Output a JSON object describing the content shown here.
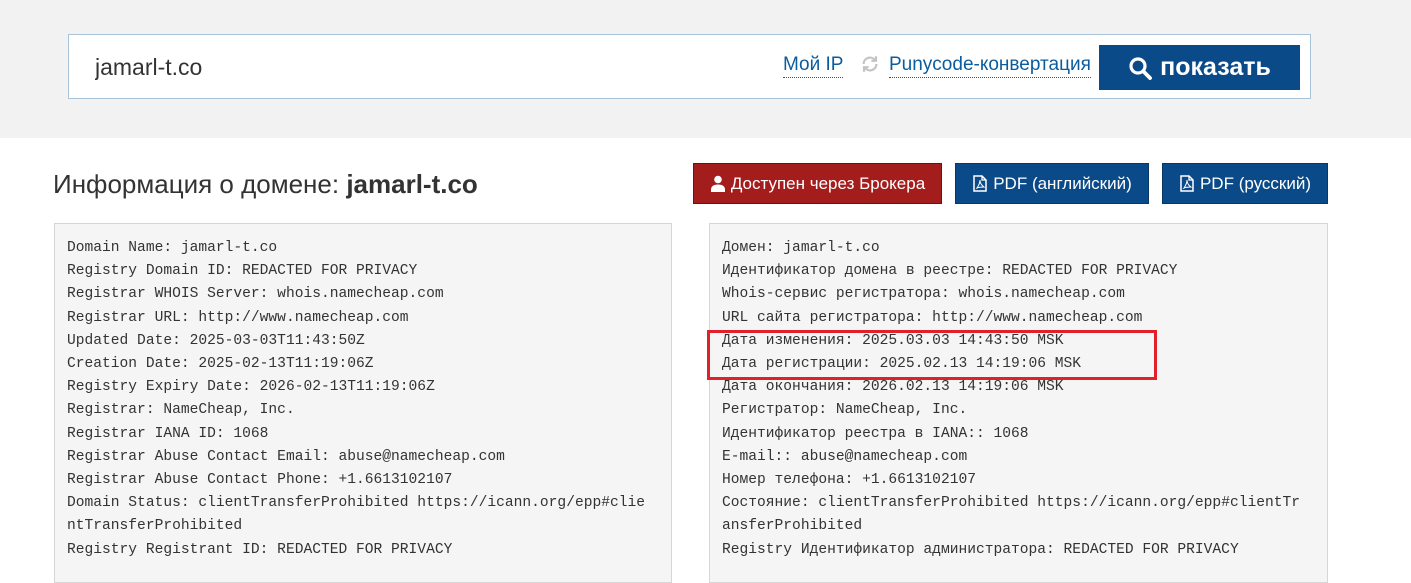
{
  "search": {
    "value": "jamarl-t.co",
    "my_ip_label": "Мой IP",
    "punycode_label": "Punycode-конвертация",
    "show_button_label": "показать"
  },
  "header": {
    "title_prefix": "Информация о домене: ",
    "domain": "jamarl-t.co"
  },
  "actions": {
    "broker_label": "Доступен через Брокера",
    "pdf_en_label": "PDF (английский)",
    "pdf_ru_label": "PDF (русский)"
  },
  "whois_en": [
    "Domain Name: jamarl-t.co",
    "Registry Domain ID: REDACTED FOR PRIVACY",
    "Registrar WHOIS Server: whois.namecheap.com",
    "Registrar URL: http://www.namecheap.com",
    "Updated Date: 2025-03-03T11:43:50Z",
    "Creation Date: 2025-02-13T11:19:06Z",
    "Registry Expiry Date: 2026-02-13T11:19:06Z",
    "Registrar: NameCheap, Inc.",
    "Registrar IANA ID: 1068",
    "Registrar Abuse Contact Email: abuse@namecheap.com",
    "Registrar Abuse Contact Phone: +1.6613102107",
    "Domain Status: clientTransferProhibited https://icann.org/epp#clie",
    "ntTransferProhibited",
    "Registry Registrant ID: REDACTED FOR PRIVACY"
  ],
  "whois_ru": [
    "Домен: jamarl-t.co",
    "Идентификатор домена в реестре: REDACTED FOR PRIVACY",
    "Whois-сервис регистратора: whois.namecheap.com",
    "URL сайта регистратора: http://www.namecheap.com",
    "Дата изменения: 2025.03.03 14:43:50 MSK",
    "Дата регистрации: 2025.02.13 14:19:06 MSK",
    "Дата окончания: 2026.02.13 14:19:06 MSK",
    "Регистратор: NameCheap, Inc.",
    "Идентификатор реестра в IANA:: 1068",
    "E-mail:: abuse@namecheap.com",
    "Номер телефона: +1.6613102107",
    "Состояние: clientTransferProhibited https://icann.org/epp#clientTr",
    "ansferProhibited",
    "Registry Идентификатор администратора: REDACTED FOR PRIVACY"
  ],
  "colors": {
    "primary": "#0b4a89",
    "broker": "#a31d1d",
    "highlight": "#e0202a"
  }
}
